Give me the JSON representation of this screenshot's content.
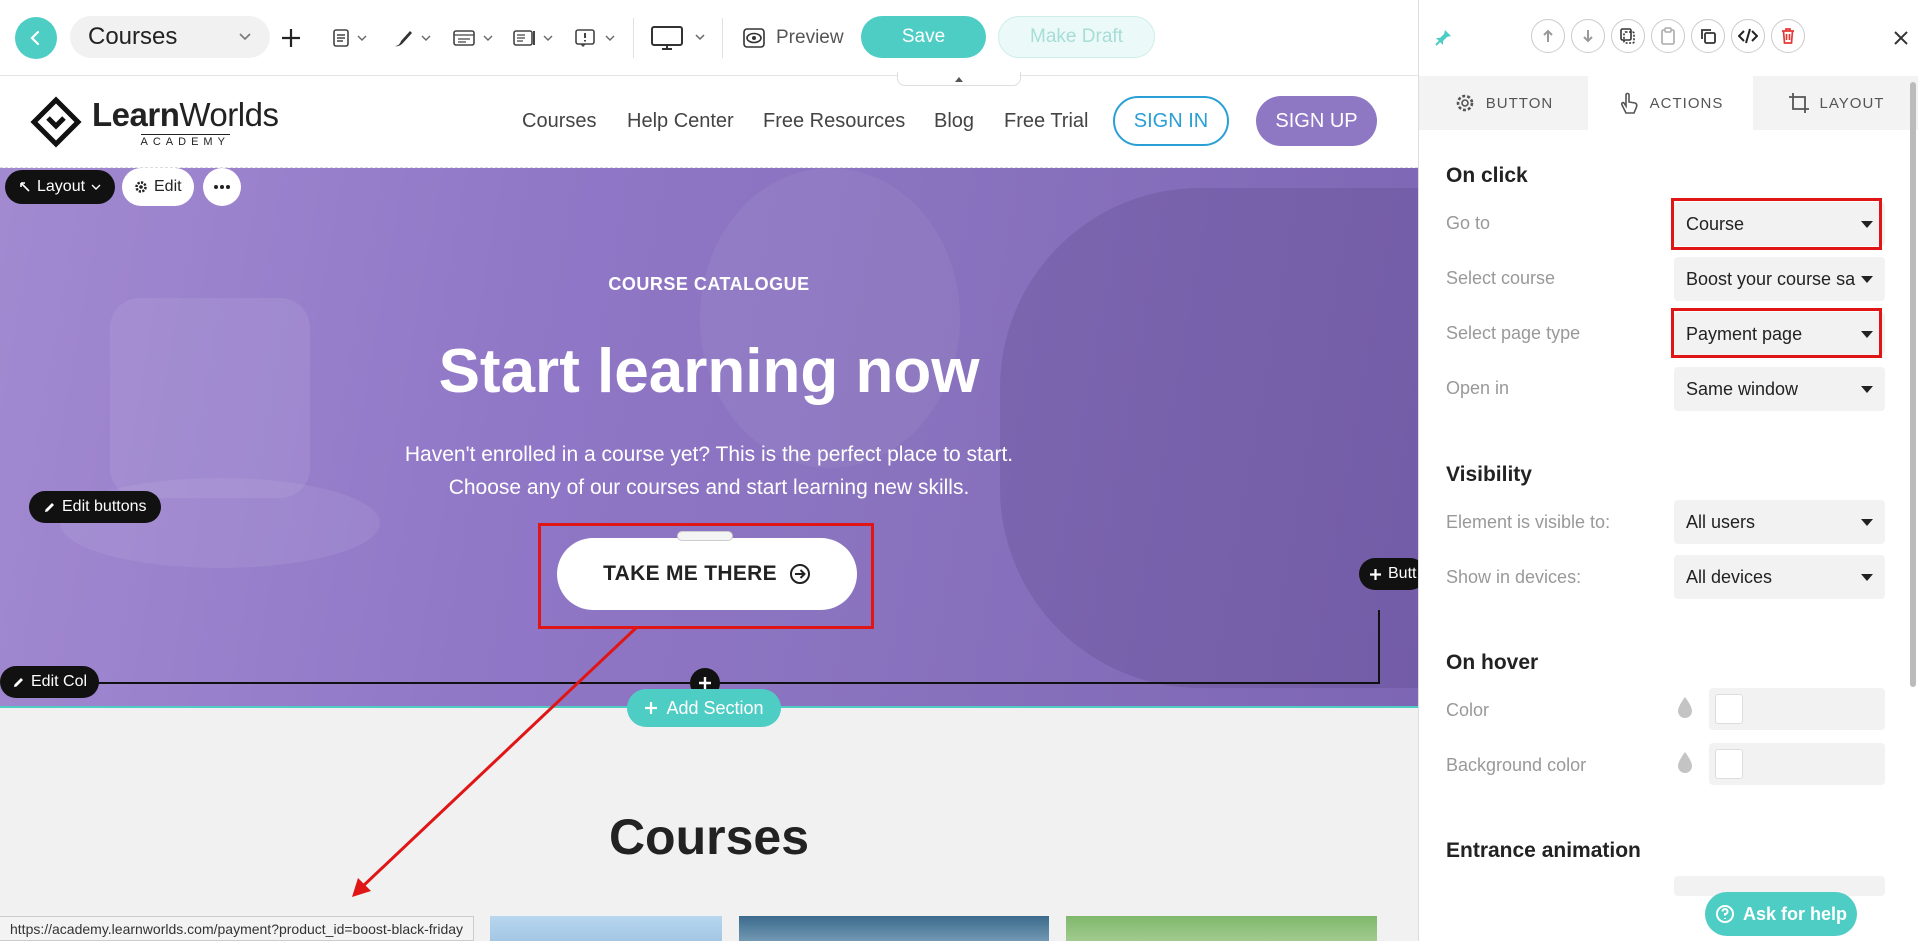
{
  "toolbar": {
    "page_select_value": "Courses",
    "preview_label": "Preview",
    "save_label": "Save",
    "make_draft_label": "Make Draft"
  },
  "site": {
    "logo_main_bold": "Learn",
    "logo_main_regular": "Worlds",
    "logo_sub": "ACADEMY",
    "nav": [
      "Courses",
      "Help Center",
      "Free Resources",
      "Blog",
      "Free Trial"
    ],
    "signin_label": "SIGN IN",
    "signup_label": "SIGN UP"
  },
  "editor_controls": {
    "layout_label": "Layout",
    "edit_label": "Edit",
    "edit_buttons_label": "Edit buttons",
    "edit_col_label": "Edit Col",
    "button_pill_label": "Butt",
    "add_section_label": "Add Section"
  },
  "hero": {
    "eyebrow": "COURSE CATALOGUE",
    "title": "Start learning now",
    "subtitle_line1": "Haven't enrolled in a course yet? This is the perfect place to start.",
    "subtitle_line2": "Choose any of our courses and start learning new skills.",
    "cta_label": "TAKE ME THERE"
  },
  "courses_section": {
    "title": "Courses"
  },
  "status_bar": {
    "url": "https://academy.learnworlds.com/payment?product_id=boost-black-friday"
  },
  "panel": {
    "tabs": [
      {
        "label": "BUTTON",
        "icon": "gear-icon"
      },
      {
        "label": "ACTIONS",
        "icon": "pointer-icon"
      },
      {
        "label": "LAYOUT",
        "icon": "crop-icon"
      }
    ],
    "active_tab": "ACTIONS",
    "on_click": {
      "heading": "On click",
      "go_to_label": "Go to",
      "go_to_value": "Course",
      "select_course_label": "Select course",
      "select_course_value": "Boost your course sa",
      "page_type_label": "Select page type",
      "page_type_value": "Payment page",
      "open_in_label": "Open in",
      "open_in_value": "Same window"
    },
    "visibility": {
      "heading": "Visibility",
      "visible_to_label": "Element is visible to:",
      "visible_to_value": "All users",
      "devices_label": "Show in devices:",
      "devices_value": "All devices"
    },
    "on_hover": {
      "heading": "On hover",
      "color_label": "Color",
      "bg_color_label": "Background color"
    },
    "entrance": {
      "heading": "Entrance animation"
    },
    "ask_help_label": "Ask for help"
  },
  "colors": {
    "accent": "#4ecdc4",
    "hero_purple": "#8f76c6",
    "highlight_red": "#e01616",
    "signin_blue": "#2a9fd6",
    "delete_red": "#e53935"
  }
}
